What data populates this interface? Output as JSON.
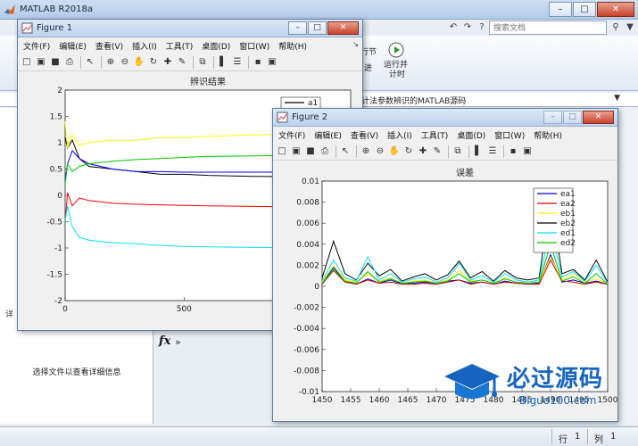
{
  "main_window": {
    "title": "MATLAB R2018a",
    "search_placeholder": "搜索文档",
    "ribbon": {
      "run_section_label": "行节",
      "advance_label": "进",
      "run_time_label_1": "运行并",
      "run_time_label_2": "计时"
    },
    "path_text": "计法参数辨识的MATLAB源码",
    "details_text": "选择文件以查看详细信息",
    "details_header": "详",
    "fx": "fx",
    "chevron": "»",
    "status": {
      "row_label": "行",
      "row_value": "1",
      "col_label": "列",
      "col_value": "1"
    },
    "colors": {
      "titlebar": "#bcd2ec",
      "close": "#c9432b"
    }
  },
  "figure1": {
    "title": "Figure 1",
    "menus": [
      "文件(F)",
      "编辑(E)",
      "查看(V)",
      "插入(I)",
      "工具(T)",
      "桌面(D)",
      "窗口(W)",
      "帮助(H)"
    ],
    "chart_data": {
      "type": "line",
      "title": "辨识结果",
      "xlim": [
        0,
        1200
      ],
      "ylim": [
        -2,
        2
      ],
      "xticks": [
        "0",
        "500",
        "1000"
      ],
      "yticks": [
        "-2",
        "-1.5",
        "-1",
        "-0.5",
        "0",
        "0.5",
        "1",
        "1.5",
        "2"
      ],
      "legend": [
        "a1"
      ],
      "series": [
        {
          "name": "a1",
          "color": "#000000",
          "x": [
            0,
            10,
            30,
            60,
            100,
            200,
            300,
            400,
            500,
            600,
            800,
            1000,
            1200
          ],
          "y": [
            1.1,
            0.9,
            1.05,
            0.7,
            0.55,
            0.5,
            0.45,
            0.4,
            0.4,
            0.38,
            0.36,
            0.35,
            0.35
          ]
        },
        {
          "color": "#0000ff",
          "x": [
            0,
            10,
            30,
            60,
            100,
            200,
            300,
            400,
            500,
            600,
            800,
            1000,
            1200
          ],
          "y": [
            0.3,
            0.6,
            0.85,
            0.7,
            0.6,
            0.5,
            0.45,
            0.45,
            0.44,
            0.44,
            0.44,
            0.44,
            0.45
          ]
        },
        {
          "color": "#ffff00",
          "x": [
            0,
            10,
            30,
            60,
            100,
            200,
            300,
            400,
            500,
            600,
            800,
            1000,
            1200
          ],
          "y": [
            1.4,
            0.9,
            1.15,
            0.95,
            1.0,
            1.05,
            1.05,
            1.1,
            1.1,
            1.12,
            1.15,
            1.17,
            1.18
          ]
        },
        {
          "color": "#00c800",
          "x": [
            0,
            10,
            30,
            60,
            100,
            200,
            300,
            400,
            500,
            600,
            800,
            1000,
            1200
          ],
          "y": [
            0.2,
            0.6,
            0.45,
            0.55,
            0.6,
            0.65,
            0.68,
            0.7,
            0.72,
            0.74,
            0.75,
            0.76,
            0.77
          ]
        },
        {
          "color": "#ff0000",
          "x": [
            0,
            10,
            30,
            60,
            100,
            200,
            300,
            400,
            500,
            600,
            800,
            1000,
            1200
          ],
          "y": [
            -0.5,
            0.05,
            -0.2,
            -0.05,
            -0.1,
            -0.15,
            -0.17,
            -0.18,
            -0.19,
            -0.2,
            -0.21,
            -0.22,
            -0.22
          ]
        },
        {
          "color": "#00e5ee",
          "x": [
            0,
            10,
            30,
            60,
            100,
            200,
            300,
            400,
            500,
            600,
            800,
            1000,
            1200
          ],
          "y": [
            -0.5,
            -0.2,
            -0.6,
            -0.8,
            -0.85,
            -0.9,
            -0.92,
            -0.95,
            -0.97,
            -0.98,
            -0.99,
            -1.0,
            -1.0
          ]
        }
      ]
    }
  },
  "figure2": {
    "title": "Figure 2",
    "menus": [
      "文件(F)",
      "编辑(E)",
      "查看(V)",
      "插入(I)",
      "工具(T)",
      "桌面(D)",
      "窗口(W)",
      "帮助(H)"
    ],
    "chart_data": {
      "type": "line",
      "title": "误差",
      "xlim": [
        1450,
        1500
      ],
      "ylim": [
        -0.01,
        0.01
      ],
      "xticks": [
        "1450",
        "1455",
        "1460",
        "1465",
        "1470",
        "1475",
        "1480",
        "1485",
        "1490",
        "1495",
        "1500"
      ],
      "yticks": [
        "-0.01",
        "-0.008",
        "-0.006",
        "-0.004",
        "-0.002",
        "0",
        "0.002",
        "0.004",
        "0.006",
        "0.008",
        "0.01"
      ],
      "legend_position": "top-right",
      "series": [
        {
          "name": "ea1",
          "color": "#0000cc",
          "x": [
            1450,
            1452,
            1454,
            1456,
            1458,
            1460,
            1462,
            1464,
            1466,
            1468,
            1470,
            1472,
            1474,
            1476,
            1478,
            1480,
            1482,
            1484,
            1486,
            1488,
            1490,
            1492,
            1494,
            1496,
            1498,
            1500
          ],
          "y": [
            0.0003,
            0.0018,
            0.0005,
            0.0002,
            0.0007,
            0.0003,
            0.0006,
            0.0002,
            0.0003,
            0.0004,
            0.0002,
            0.0005,
            0.0006,
            0.0003,
            0.0004,
            0.0002,
            0.0005,
            0.0003,
            0.0002,
            0.0003,
            0.003,
            0.0004,
            0.0006,
            0.0003,
            0.0005,
            0.0002
          ]
        },
        {
          "name": "ea2",
          "color": "#dd0000",
          "x": [
            1450,
            1452,
            1454,
            1456,
            1458,
            1460,
            1462,
            1464,
            1466,
            1468,
            1470,
            1472,
            1474,
            1476,
            1478,
            1480,
            1482,
            1484,
            1486,
            1488,
            1490,
            1492,
            1494,
            1496,
            1498,
            1500
          ],
          "y": [
            0.0002,
            0.0015,
            0.0004,
            0.0002,
            0.0006,
            0.0003,
            0.0004,
            0.0002,
            0.0002,
            0.0003,
            0.0002,
            0.0004,
            0.0006,
            0.0002,
            0.0004,
            0.0002,
            0.0004,
            0.0003,
            0.0002,
            0.0002,
            0.0025,
            0.0005,
            0.0004,
            0.0002,
            0.0004,
            0.0002
          ]
        },
        {
          "name": "eb1",
          "color": "#ffee00",
          "x": [
            1450,
            1452,
            1454,
            1456,
            1458,
            1460,
            1462,
            1464,
            1466,
            1468,
            1470,
            1472,
            1474,
            1476,
            1478,
            1480,
            1482,
            1484,
            1486,
            1488,
            1490,
            1492,
            1494,
            1496,
            1498,
            1500
          ],
          "y": [
            0.0004,
            0.002,
            0.0006,
            0.0004,
            0.0012,
            0.0005,
            0.0008,
            0.0003,
            0.0005,
            0.0006,
            0.0003,
            0.0006,
            0.0015,
            0.0005,
            0.0006,
            0.0003,
            0.0008,
            0.0004,
            0.0003,
            0.0004,
            0.0028,
            0.0006,
            0.0012,
            0.0004,
            0.0007,
            0.0003
          ]
        },
        {
          "name": "eb2",
          "color": "#000000",
          "x": [
            1450,
            1452,
            1454,
            1456,
            1458,
            1460,
            1462,
            1464,
            1466,
            1468,
            1470,
            1472,
            1474,
            1476,
            1478,
            1480,
            1482,
            1484,
            1486,
            1488,
            1490,
            1492,
            1494,
            1496,
            1498,
            1500
          ],
          "y": [
            0.0008,
            0.0043,
            0.0012,
            0.0006,
            0.0022,
            0.001,
            0.0016,
            0.0005,
            0.0009,
            0.0012,
            0.0006,
            0.0011,
            0.0024,
            0.0008,
            0.0014,
            0.0005,
            0.0015,
            0.0008,
            0.0006,
            0.0008,
            0.0085,
            0.0012,
            0.0016,
            0.0006,
            0.0025,
            0.0004
          ]
        },
        {
          "name": "ed1",
          "color": "#00e5ee",
          "x": [
            1450,
            1452,
            1454,
            1456,
            1458,
            1460,
            1462,
            1464,
            1466,
            1468,
            1470,
            1472,
            1474,
            1476,
            1478,
            1480,
            1482,
            1484,
            1486,
            1488,
            1490,
            1492,
            1494,
            1496,
            1498,
            1500
          ],
          "y": [
            0.0005,
            0.0025,
            0.0008,
            0.0005,
            0.0028,
            0.0006,
            0.0012,
            0.0004,
            0.0007,
            0.0009,
            0.0004,
            0.0008,
            0.0022,
            0.0006,
            0.001,
            0.0004,
            0.0012,
            0.0006,
            0.0004,
            0.0006,
            0.0055,
            0.0009,
            0.0014,
            0.0005,
            0.002,
            0.0003
          ]
        },
        {
          "name": "ed2",
          "color": "#00c800",
          "x": [
            1450,
            1452,
            1454,
            1456,
            1458,
            1460,
            1462,
            1464,
            1466,
            1468,
            1470,
            1472,
            1474,
            1476,
            1478,
            1480,
            1482,
            1484,
            1486,
            1488,
            1490,
            1492,
            1494,
            1496,
            1498,
            1500
          ],
          "y": [
            0.0003,
            0.0016,
            0.0005,
            0.0003,
            0.0014,
            0.0004,
            0.0007,
            0.0003,
            0.0004,
            0.0005,
            0.0003,
            0.0005,
            0.0012,
            0.0004,
            0.0006,
            0.0003,
            0.0007,
            0.0004,
            0.0003,
            0.0004,
            0.004,
            0.0005,
            0.0009,
            0.0003,
            0.0012,
            0.0002
          ]
        }
      ]
    }
  },
  "watermark": {
    "text": "必过源码",
    "subtext": "Biguo100.com"
  }
}
